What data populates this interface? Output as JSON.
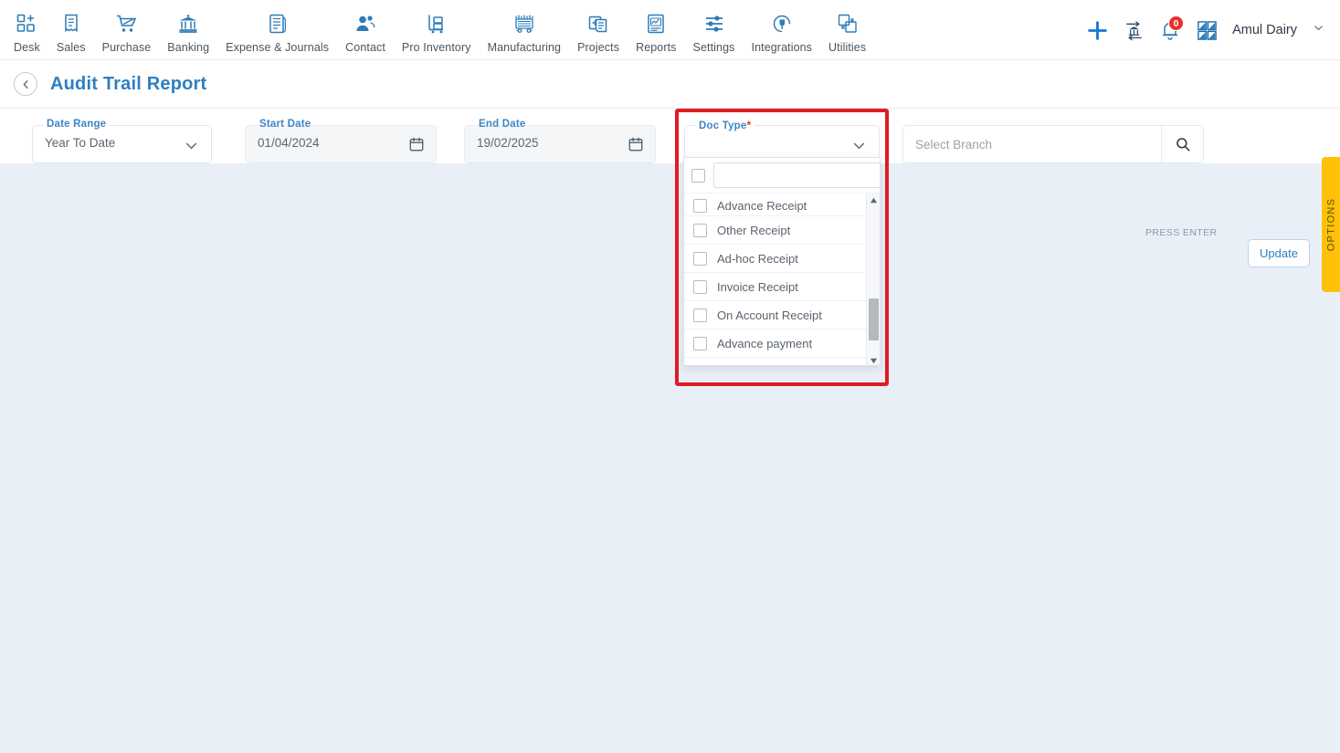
{
  "topnav": {
    "items": [
      {
        "label": "Desk",
        "icon": "desk-grid-plus-icon"
      },
      {
        "label": "Sales",
        "icon": "sales-receipt-icon"
      },
      {
        "label": "Purchase",
        "icon": "purchase-cart-icon"
      },
      {
        "label": "Banking",
        "icon": "banking-bank-icon"
      },
      {
        "label": "Expense & Journals",
        "icon": "expense-journal-book-icon"
      },
      {
        "label": "Contact",
        "icon": "contact-people-icon"
      },
      {
        "label": "Pro Inventory",
        "icon": "inventory-trolley-icon"
      },
      {
        "label": "Manufacturing",
        "icon": "manufacturing-machine-icon"
      },
      {
        "label": "Projects",
        "icon": "projects-clipboard-icon"
      },
      {
        "label": "Reports",
        "icon": "reports-chart-document-icon"
      },
      {
        "label": "Settings",
        "icon": "settings-sliders-icon"
      },
      {
        "label": "Integrations",
        "icon": "integrations-plug-icon"
      },
      {
        "label": "Utilities",
        "icon": "utilities-transform-icon"
      }
    ],
    "add_label": "add-new",
    "bank_label": "bank-transfer",
    "notification_count": "0",
    "apps_label": "apps-grid",
    "company_name": "Amul Dairy"
  },
  "page": {
    "title": "Audit Trail Report",
    "back_label": "back"
  },
  "filters": {
    "date_range": {
      "label": "Date Range",
      "value": "Year To Date"
    },
    "start_date": {
      "label": "Start Date",
      "value": "01/04/2024"
    },
    "end_date": {
      "label": "End Date",
      "value": "19/02/2025"
    },
    "doc_type": {
      "label": "Doc Type",
      "required_marker": "*",
      "value": ""
    },
    "branch": {
      "placeholder": "Select Branch",
      "value": "",
      "hint": "PRESS ENTER"
    },
    "update_button": "Update"
  },
  "doc_type_dropdown": {
    "search_value": "",
    "search_placeholder": "",
    "select_all_checked": false,
    "clear_label": "×",
    "options": [
      {
        "label": "Advance Receipt",
        "checked": false
      },
      {
        "label": "Other Receipt",
        "checked": false
      },
      {
        "label": "Ad-hoc Receipt",
        "checked": false
      },
      {
        "label": "Invoice Receipt",
        "checked": false
      },
      {
        "label": "On Account Receipt",
        "checked": false
      },
      {
        "label": "Advance payment",
        "checked": false
      }
    ]
  },
  "options_tab": {
    "label": "OPTIONS"
  },
  "colors": {
    "accent_blue": "#2f7fc1",
    "nav_icon_blue": "#2d7cb8",
    "highlight_red": "#e01b22",
    "badge_red": "#e8302a",
    "options_yellow": "#ffc107",
    "page_bg": "#e9eff7"
  }
}
